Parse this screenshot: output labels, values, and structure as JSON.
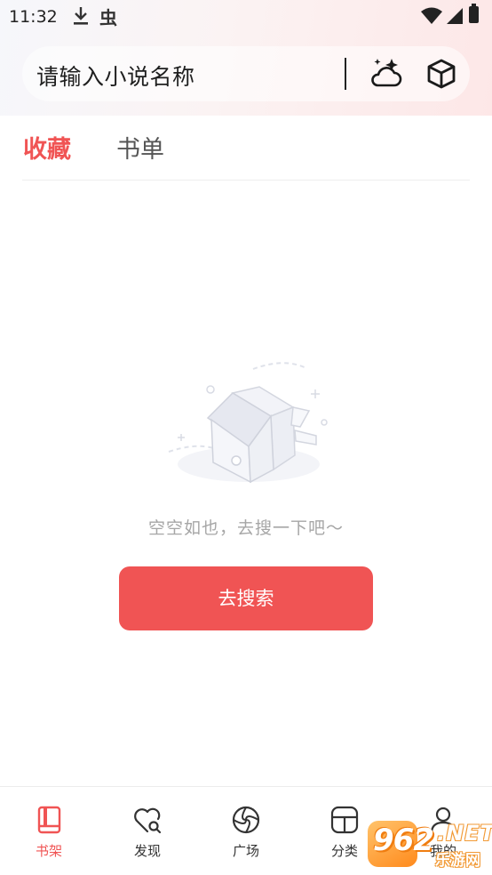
{
  "status_bar": {
    "time": "11:32",
    "icons": [
      "download-icon",
      "app-notification-icon",
      "wifi-icon",
      "signal-icon",
      "battery-icon"
    ],
    "app_glyph": "虫"
  },
  "search": {
    "placeholder": "请输入小说名称",
    "icons": [
      "weather-icon",
      "cube-icon"
    ]
  },
  "tabs": [
    {
      "label": "收藏",
      "active": true
    },
    {
      "label": "书单",
      "active": false
    }
  ],
  "empty_state": {
    "message": "空空如也，去搜一下吧～",
    "button_label": "去搜索"
  },
  "bottom_nav": [
    {
      "label": "书架",
      "icon": "bookshelf-icon",
      "active": true
    },
    {
      "label": "发现",
      "icon": "discover-icon",
      "active": false
    },
    {
      "label": "广场",
      "icon": "plaza-icon",
      "active": false
    },
    {
      "label": "分类",
      "icon": "category-icon",
      "active": false
    },
    {
      "label": "我的",
      "icon": "profile-icon",
      "active": false
    }
  ],
  "watermark": {
    "number": "962",
    "suffix": ".NET",
    "sub": "乐游网"
  },
  "colors": {
    "accent": "#f05454",
    "text_muted": "#a6a6a6",
    "tab_inactive": "#555555"
  }
}
